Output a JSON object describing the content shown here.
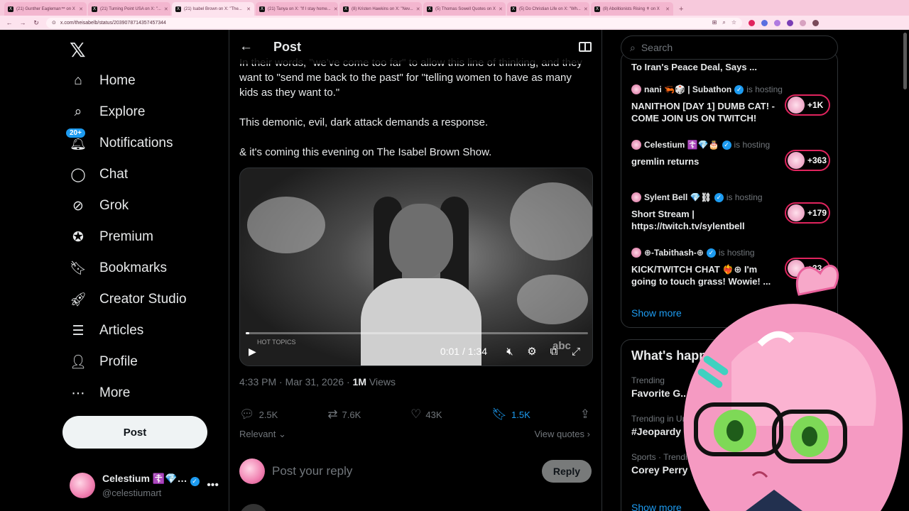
{
  "browser": {
    "tabs": [
      {
        "label": "(21) Gunther Eagleman™ on X",
        "active": false
      },
      {
        "label": "(21) Turning Point USA on X: \"...",
        "active": false
      },
      {
        "label": "(21) Isabel Brown on X: \"The...",
        "active": true
      },
      {
        "label": "(21) Tanya on X: \"If I stay home...",
        "active": false
      },
      {
        "label": "(8) Kristen Hawkins on X: \"Nev...",
        "active": false
      },
      {
        "label": "(5) Thomas Sowell Quotes on X",
        "active": false
      },
      {
        "label": "(5) Do Christian Life on X: \"Wh...",
        "active": false
      },
      {
        "label": "(8) Abolitionists Rising ✝ on X",
        "active": false
      }
    ],
    "url": "x.com/theisabelb/status/2039078714357457344"
  },
  "nav": {
    "items": [
      {
        "label": "Home",
        "icon": "home-icon"
      },
      {
        "label": "Explore",
        "icon": "search-icon"
      },
      {
        "label": "Notifications",
        "icon": "bell-icon",
        "badge": "20+"
      },
      {
        "label": "Chat",
        "icon": "chat-icon"
      },
      {
        "label": "Grok",
        "icon": "grok-icon"
      },
      {
        "label": "Premium",
        "icon": "premium-icon"
      },
      {
        "label": "Bookmarks",
        "icon": "bookmark-icon"
      },
      {
        "label": "Creator Studio",
        "icon": "rocket-icon"
      },
      {
        "label": "Articles",
        "icon": "articles-icon"
      },
      {
        "label": "Profile",
        "icon": "person-icon"
      },
      {
        "label": "More",
        "icon": "more-circle-icon"
      }
    ],
    "post_label": "Post",
    "account": {
      "name": "Celestium ☦️💎…",
      "handle": "@celestiumart"
    }
  },
  "post": {
    "header_title": "Post",
    "text_lines": [
      "In their words, \"we've come too far\" to allow this line of thinking, and they want to \"send me back to the past\" for \"telling women to have as many kids as they want to.\"",
      "This demonic, evil, dark attack demands a response.",
      "& it's coming this evening on The Isabel Brown Show."
    ],
    "video": {
      "time": "0:01 / 1:34",
      "progress": 0.01,
      "watermark_left": "HOT TOPICS",
      "watermark_right": "abc"
    },
    "timestamp": "4:33 PM · Mar 31, 2026 · ",
    "views_count": "1M",
    "views_label": " Views",
    "actions": {
      "replies": "2.5K",
      "reposts": "7.6K",
      "likes": "43K",
      "bookmarks": "1.5K"
    },
    "sort_label": "Relevant",
    "view_quotes": "View quotes",
    "reply_placeholder": "Post your reply",
    "reply_button": "Reply"
  },
  "sidebar": {
    "search_placeholder": "Search",
    "partial_headline": "To Iran's Peace Deal, Says ...",
    "live": [
      {
        "host": "nani 🦐🎲 | Subathon",
        "status": "is hosting",
        "title": "NANITHON [DAY 1] DUMB CAT! - COME JOIN US ON TWITCH!",
        "count": "+1K"
      },
      {
        "host": "Celestium ☦️💎🎂",
        "status": "is hosting",
        "title": "gremlin returns",
        "count": "+363"
      },
      {
        "host": "Sylent Bell 💎⛓",
        "status": "is hosting",
        "title": "Short Stream | https://twitch.tv/sylentbell",
        "count": "+179"
      },
      {
        "host": "⊕-Tabithash-⊕",
        "status": "is hosting",
        "title": "KICK/TWITCH CHAT ❤️‍🔥⊕ I'm going to touch grass! Wowie! ...",
        "count": "+33"
      }
    ],
    "show_more": "Show more",
    "trends_title": "What's happening",
    "trends": [
      {
        "category": "Trending",
        "name": "Favorite G..."
      },
      {
        "category": "Trending in Un...",
        "name": "#Jeopardy"
      },
      {
        "category": "Sports · Trending",
        "name": "Corey Perry"
      }
    ],
    "show_more_2": "Show more"
  }
}
